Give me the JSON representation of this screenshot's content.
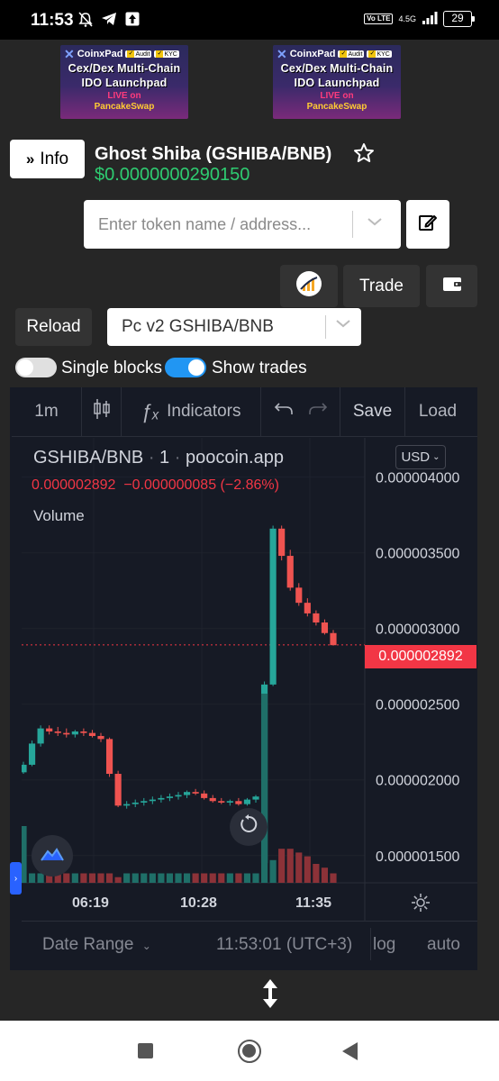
{
  "status_bar": {
    "time": "11:53",
    "network": "4.5G",
    "volte": "Vo LTE",
    "battery": "29"
  },
  "banners": [
    {
      "brand": "CoinxPad",
      "audit": "Audit",
      "kyc": "KYC",
      "line1": "Cex/Dex Multi-Chain",
      "line2": "IDO Launchpad",
      "live": "LIVE on",
      "exchange": "PancakeSwap"
    },
    {
      "brand": "CoinxPad",
      "audit": "Audit",
      "kyc": "KYC",
      "line1": "Cex/Dex Multi-Chain",
      "line2": "IDO Launchpad",
      "live": "LIVE on",
      "exchange": "PancakeSwap"
    }
  ],
  "header": {
    "info_label": "Info",
    "token_name": "Ghost Shiba (GSHIBA/BNB)",
    "token_price": "$0.0000000290150"
  },
  "search": {
    "placeholder": "Enter token name / address..."
  },
  "toolbar": {
    "trade_label": "Trade"
  },
  "controls": {
    "reload_label": "Reload",
    "pair_value": "Pc v2 GSHIBA/BNB",
    "single_blocks_label": "Single blocks",
    "single_blocks_on": false,
    "show_trades_label": "Show trades",
    "show_trades_on": true
  },
  "chart_toolbar": {
    "interval": "1m",
    "indicators": "Indicators",
    "save": "Save",
    "load": "Load"
  },
  "chart_legend": {
    "symbol": "GSHIBA/BNB",
    "interval": "1",
    "source": "poocoin.app",
    "last_price": "0.000002892",
    "change": "−0.000000085 (−2.86%)",
    "volume_label": "Volume",
    "currency": "USD"
  },
  "chart_data": {
    "type": "candlestick",
    "currency": "USD",
    "y_ticks": [
      "0.000004000",
      "0.000003500",
      "0.000003000",
      "0.000002500",
      "0.000002000",
      "0.000001500"
    ],
    "ylim": [
      1.32e-06,
      4.26e-06
    ],
    "x_ticks": [
      "06:19",
      "10:28",
      "11:35"
    ],
    "current_price": "0.000002892",
    "current_price_value": 2.892e-06,
    "candles": [
      {
        "o": 2.05e-06,
        "h": 2.12e-06,
        "l": 2.04e-06,
        "c": 2.1e-06
      },
      {
        "o": 2.1e-06,
        "h": 2.26e-06,
        "l": 2.09e-06,
        "c": 2.24e-06
      },
      {
        "o": 2.24e-06,
        "h": 2.36e-06,
        "l": 2.22e-06,
        "c": 2.34e-06
      },
      {
        "o": 2.34e-06,
        "h": 2.36e-06,
        "l": 2.3e-06,
        "c": 2.32e-06
      },
      {
        "o": 2.32e-06,
        "h": 2.35e-06,
        "l": 2.29e-06,
        "c": 2.31e-06
      },
      {
        "o": 2.31e-06,
        "h": 2.34e-06,
        "l": 2.28e-06,
        "c": 2.3e-06
      },
      {
        "o": 2.3e-06,
        "h": 2.33e-06,
        "l": 2.28e-06,
        "c": 2.32e-06
      },
      {
        "o": 2.32e-06,
        "h": 2.34e-06,
        "l": 2.29e-06,
        "c": 2.31e-06
      },
      {
        "o": 2.31e-06,
        "h": 2.33e-06,
        "l": 2.28e-06,
        "c": 2.29e-06
      },
      {
        "o": 2.29e-06,
        "h": 2.31e-06,
        "l": 2.25e-06,
        "c": 2.27e-06
      },
      {
        "o": 2.27e-06,
        "h": 2.28e-06,
        "l": 2.02e-06,
        "c": 2.04e-06
      },
      {
        "o": 2.04e-06,
        "h": 2.06e-06,
        "l": 1.82e-06,
        "c": 1.83e-06
      },
      {
        "o": 1.83e-06,
        "h": 1.86e-06,
        "l": 1.81e-06,
        "c": 1.84e-06
      },
      {
        "o": 1.84e-06,
        "h": 1.87e-06,
        "l": 1.82e-06,
        "c": 1.85e-06
      },
      {
        "o": 1.85e-06,
        "h": 1.88e-06,
        "l": 1.83e-06,
        "c": 1.86e-06
      },
      {
        "o": 1.86e-06,
        "h": 1.89e-06,
        "l": 1.84e-06,
        "c": 1.87e-06
      },
      {
        "o": 1.87e-06,
        "h": 1.9e-06,
        "l": 1.85e-06,
        "c": 1.88e-06
      },
      {
        "o": 1.88e-06,
        "h": 1.91e-06,
        "l": 1.86e-06,
        "c": 1.89e-06
      },
      {
        "o": 1.89e-06,
        "h": 1.92e-06,
        "l": 1.87e-06,
        "c": 1.9e-06
      },
      {
        "o": 1.9e-06,
        "h": 1.93e-06,
        "l": 1.88e-06,
        "c": 1.92e-06
      },
      {
        "o": 1.92e-06,
        "h": 1.94e-06,
        "l": 1.9e-06,
        "c": 1.91e-06
      },
      {
        "o": 1.91e-06,
        "h": 1.93e-06,
        "l": 1.87e-06,
        "c": 1.88e-06
      },
      {
        "o": 1.88e-06,
        "h": 1.9e-06,
        "l": 1.85e-06,
        "c": 1.86e-06
      },
      {
        "o": 1.86e-06,
        "h": 1.88e-06,
        "l": 1.84e-06,
        "c": 1.85e-06
      },
      {
        "o": 1.85e-06,
        "h": 1.87e-06,
        "l": 1.83e-06,
        "c": 1.86e-06
      },
      {
        "o": 1.86e-06,
        "h": 1.88e-06,
        "l": 1.83e-06,
        "c": 1.84e-06
      },
      {
        "o": 1.84e-06,
        "h": 1.88e-06,
        "l": 1.83e-06,
        "c": 1.87e-06
      },
      {
        "o": 1.87e-06,
        "h": 1.9e-06,
        "l": 1.85e-06,
        "c": 1.89e-06
      },
      {
        "o": 1.45e-06,
        "h": 2.65e-06,
        "l": 1.4e-06,
        "c": 2.63e-06
      },
      {
        "o": 2.63e-06,
        "h": 3.68e-06,
        "l": 2.62e-06,
        "c": 3.66e-06
      },
      {
        "o": 3.66e-06,
        "h": 3.68e-06,
        "l": 3.45e-06,
        "c": 3.48e-06
      },
      {
        "o": 3.48e-06,
        "h": 3.52e-06,
        "l": 3.25e-06,
        "c": 3.27e-06
      },
      {
        "o": 3.27e-06,
        "h": 3.3e-06,
        "l": 3.15e-06,
        "c": 3.17e-06
      },
      {
        "o": 3.17e-06,
        "h": 3.2e-06,
        "l": 3.08e-06,
        "c": 3.1e-06
      },
      {
        "o": 3.1e-06,
        "h": 3.12e-06,
        "l": 3.02e-06,
        "c": 3.04e-06
      },
      {
        "o": 3.04e-06,
        "h": 3.06e-06,
        "l": 2.96e-06,
        "c": 2.97e-06
      },
      {
        "o": 2.97e-06,
        "h": 2.99e-06,
        "l": 2.89e-06,
        "c": 2.89e-06
      }
    ],
    "volume": [
      0.3,
      0.05,
      0.05,
      0.05,
      0.05,
      0.05,
      0.05,
      0.05,
      0.05,
      0.05,
      0.05,
      0.15,
      0.05,
      0.05,
      0.05,
      0.05,
      0.05,
      0.05,
      0.05,
      0.05,
      0.05,
      0.05,
      0.05,
      0.05,
      0.05,
      0.05,
      0.05,
      0.05,
      1.0,
      0.12,
      0.18,
      0.18,
      0.16,
      0.14,
      0.1,
      0.08,
      0.05
    ],
    "volume_spike_index": 11,
    "up_color": "#26a69a",
    "down_color": "#ef5350"
  },
  "chart_footer": {
    "date_range": "Date Range",
    "clock": "11:53:01 (UTC+3)",
    "log": "log",
    "auto": "auto"
  }
}
